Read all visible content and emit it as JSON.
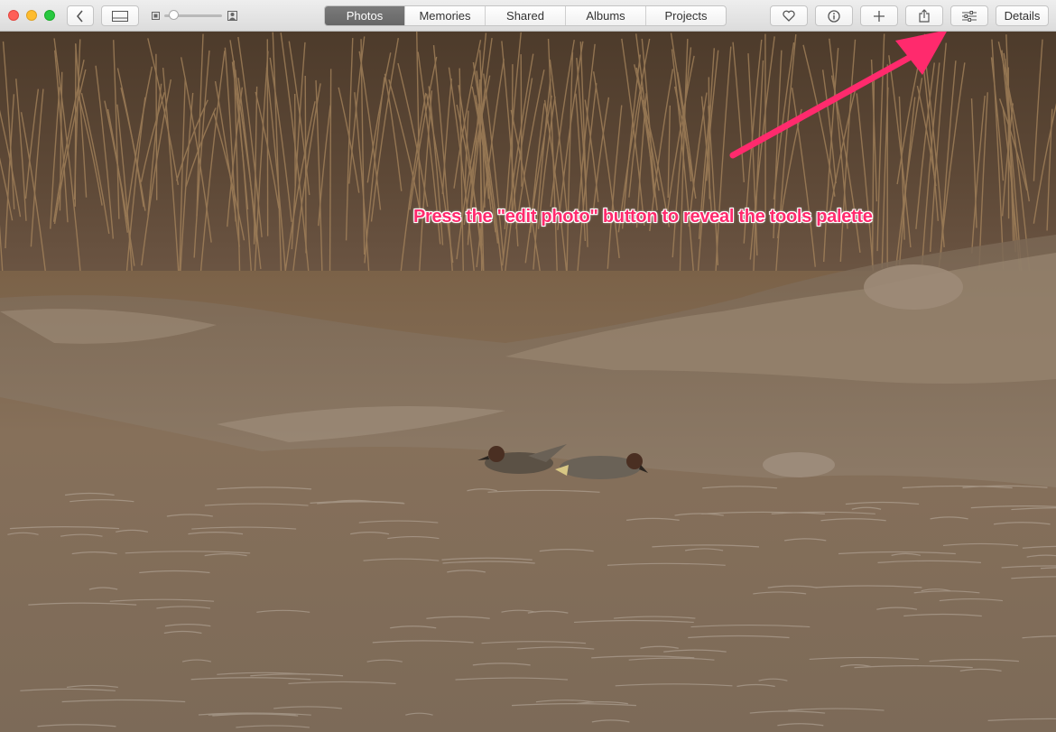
{
  "window": {
    "controls": [
      "close",
      "minimize",
      "zoom"
    ],
    "colors": {
      "close": "#ff5f57",
      "minimize": "#febc2e",
      "zoom": "#28c840"
    }
  },
  "toolbar": {
    "back_icon": "chevron-left-icon",
    "view_icon": "sidebar-view-icon",
    "zoom_slider": {
      "value": 0.1,
      "min_icon": "small-photo-icon",
      "max_icon": "large-photo-icon"
    },
    "tabs": [
      {
        "label": "Photos",
        "active": true
      },
      {
        "label": "Memories",
        "active": false
      },
      {
        "label": "Shared",
        "active": false
      },
      {
        "label": "Albums",
        "active": false
      },
      {
        "label": "Projects",
        "active": false
      }
    ],
    "actions": [
      {
        "name": "favorite-button",
        "icon": "heart-icon"
      },
      {
        "name": "info-button",
        "icon": "info-icon"
      },
      {
        "name": "add-button",
        "icon": "plus-icon"
      },
      {
        "name": "share-button",
        "icon": "share-icon"
      },
      {
        "name": "edit-photo-button",
        "icon": "sliders-icon"
      }
    ],
    "details_label": "Details"
  },
  "annotation": {
    "text": "Press the \"edit photo\" button to reveal the tools palette",
    "color": "#ff2a6d"
  }
}
